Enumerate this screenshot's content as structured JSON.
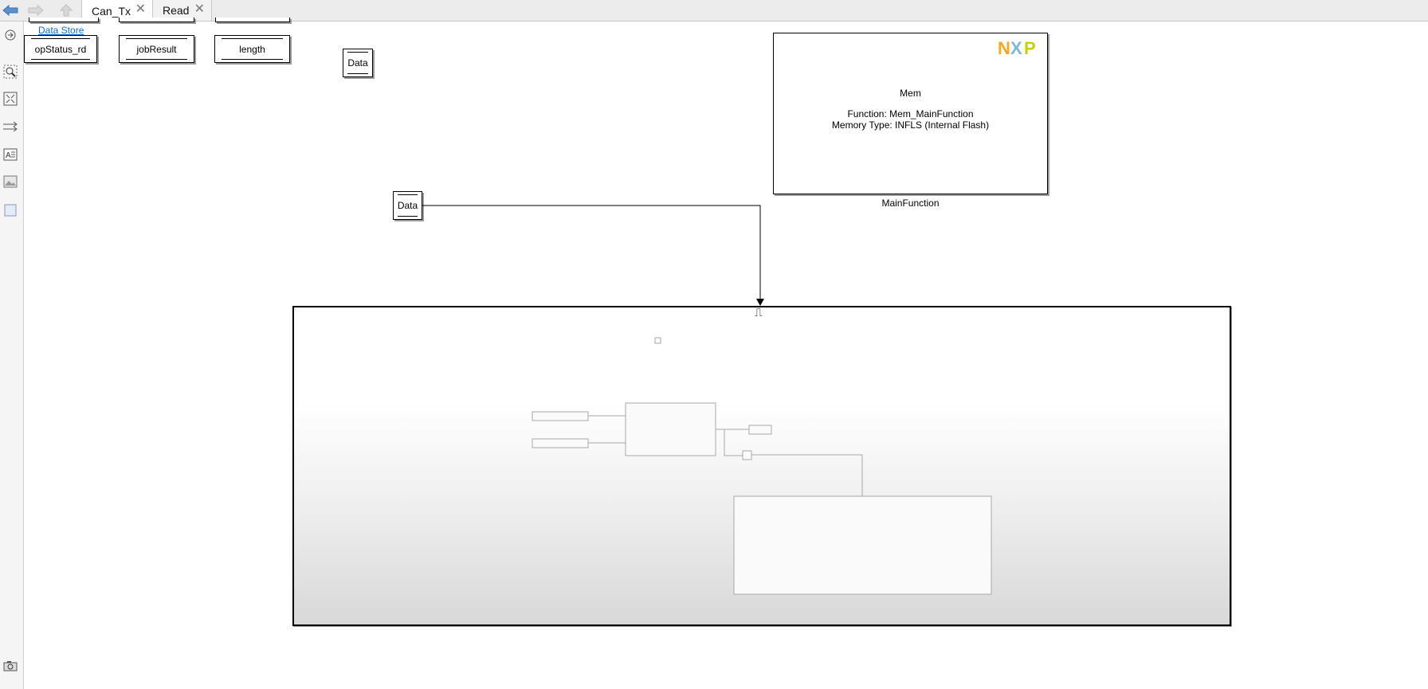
{
  "tabs": [
    {
      "label": "Can_Tx",
      "active": true
    },
    {
      "label": "Read",
      "active": false
    }
  ],
  "nav": {
    "back": "back-arrow-icon",
    "forward": "forward-arrow-icon",
    "up": "up-arrow-icon"
  },
  "palette": [
    "hide-toggle-icon",
    "zoom-icon",
    "fit-to-view-icon",
    "arrow-routing-icon",
    "annotation-icon",
    "image-icon",
    "area-icon",
    "screenshot-icon"
  ],
  "canvas": {
    "data_store_link": "Data Store",
    "blocks": {
      "opstatus": "opStatus_rd",
      "jobresult": "jobResult",
      "length": "length",
      "data1": "Data",
      "data2": "Data"
    },
    "mem_block": {
      "title": "Mem",
      "function_line": "Function: Mem_MainFunction",
      "memory_line": "Memory Type: INFLS (Internal Flash)",
      "caption": "MainFunction",
      "logo": "nxp-logo"
    },
    "trigger_symbol": "⎍"
  },
  "colors": {
    "link": "#0a6fd6",
    "nxp_orange": "#f7a81b",
    "nxp_blue": "#7ab8d9",
    "nxp_green": "#c9d200"
  }
}
